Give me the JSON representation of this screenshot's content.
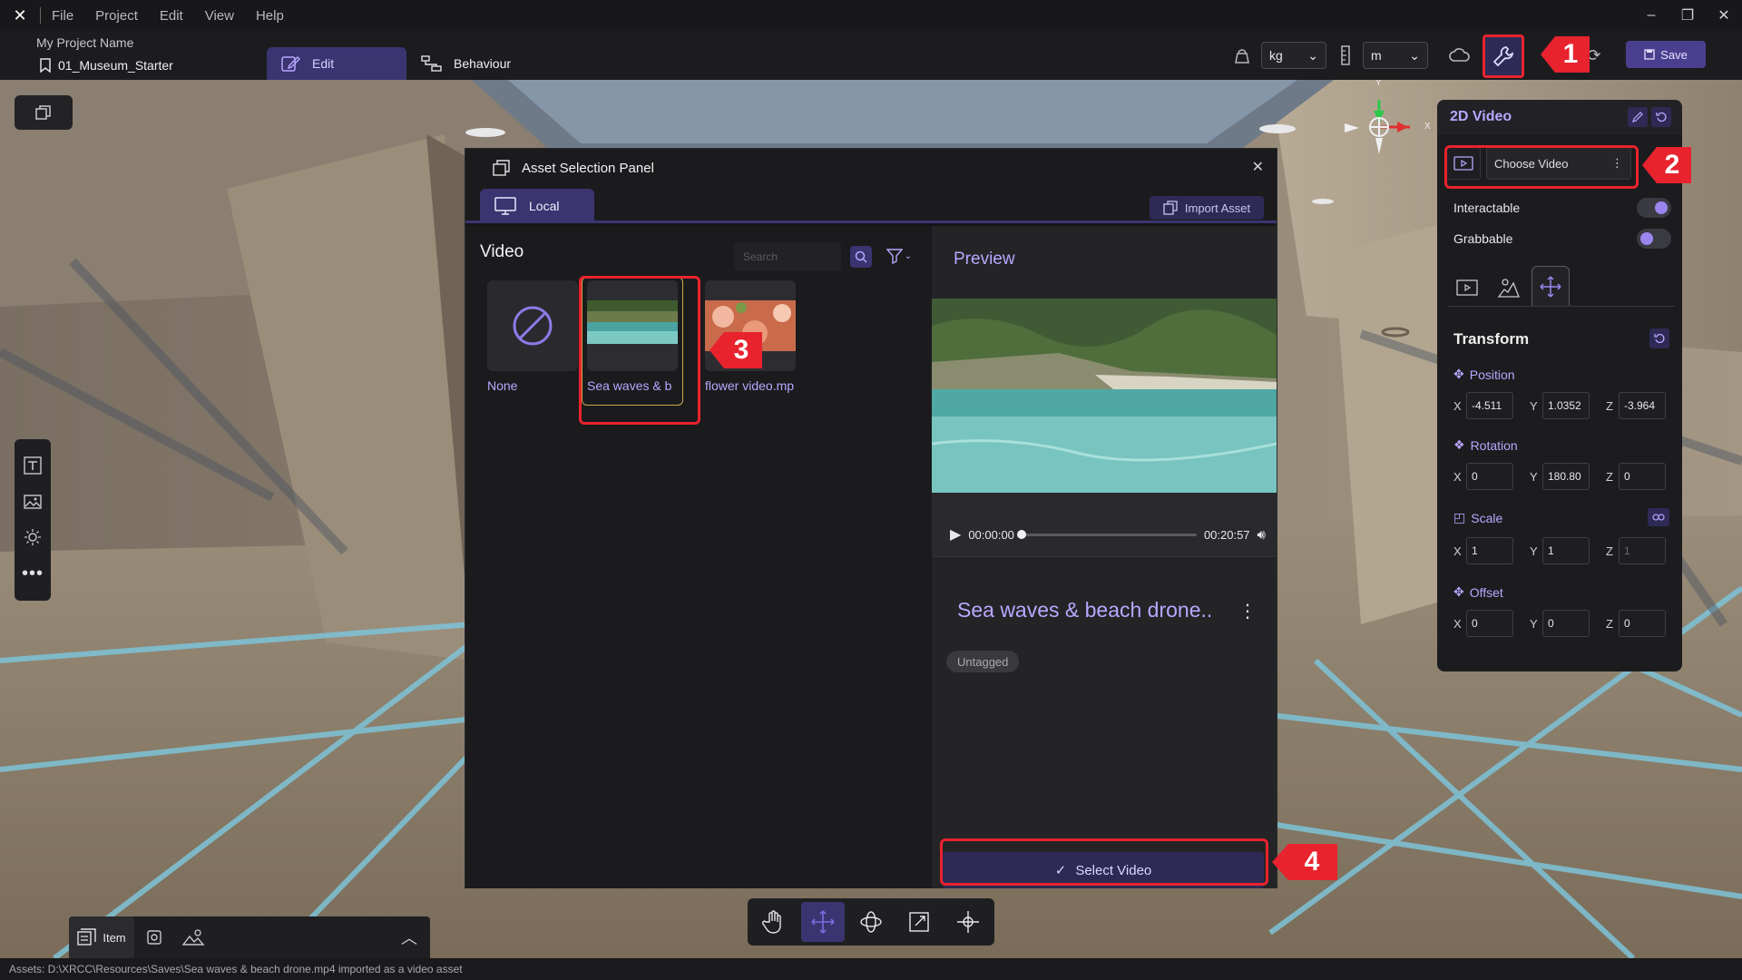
{
  "menubar": {
    "items": [
      "File",
      "Project",
      "Edit",
      "View",
      "Help"
    ]
  },
  "toolbar": {
    "project_name": "My Project Name",
    "scene_name": "01_Museum_Starter",
    "edit_tab": "Edit",
    "behaviour_tab": "Behaviour",
    "mass_unit": "kg",
    "length_unit": "m",
    "save_label": "Save"
  },
  "asset_panel": {
    "title": "Asset Selection Panel",
    "local_tab": "Local",
    "import_label": "Import Asset",
    "section_title": "Video",
    "search_placeholder": "Search",
    "items": [
      {
        "label": "None"
      },
      {
        "label": "Sea waves & b"
      },
      {
        "label": "flower video.mp"
      }
    ]
  },
  "preview": {
    "heading": "Preview",
    "current_time": "00:00:00",
    "duration": "00:20:57",
    "progress": 0,
    "file_title": "Sea waves & beach drone..",
    "tag": "Untagged",
    "select_label": "Select Video"
  },
  "props": {
    "title": "2D Video",
    "choose_video": "Choose Video",
    "interactable_label": "Interactable",
    "interactable_on": true,
    "grabbable_label": "Grabbable",
    "grabbable_on": false,
    "transform_title": "Transform",
    "position_label": "Position",
    "position": {
      "x": "-4.511",
      "y": "1.0352",
      "z": "-3.964"
    },
    "rotation_label": "Rotation",
    "rotation": {
      "x": "0",
      "y": "180.80",
      "z": "0"
    },
    "scale_label": "Scale",
    "scale": {
      "x": "1",
      "y": "1",
      "z": "1"
    },
    "offset_label": "Offset",
    "offset": {
      "x": "0",
      "y": "0",
      "z": "0"
    }
  },
  "gizmo": {
    "y_label": "Y",
    "x_label": "X"
  },
  "bottom_left": {
    "item_label": "Item"
  },
  "status": "Assets: D:\\XRCC\\Resources\\Saves\\Sea waves & beach drone.mp4 imported as a video asset",
  "callouts": [
    "1",
    "2",
    "3",
    "4"
  ],
  "colors": {
    "accent": "#b9a7ff",
    "accent_dark": "#3a3470",
    "highlight": "#e8232e"
  }
}
